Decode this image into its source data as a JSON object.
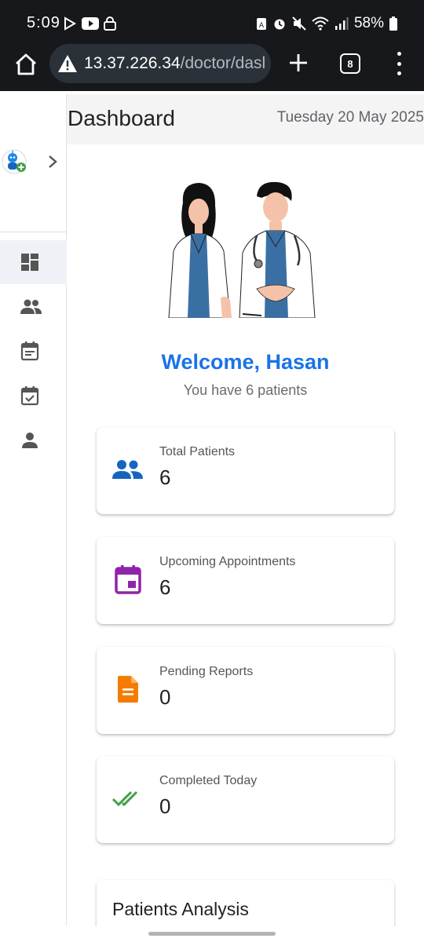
{
  "status_bar": {
    "time": "5:09",
    "battery_percent": "58%",
    "bg_color": "#17181c"
  },
  "browser": {
    "url_host": "13.37.226.34",
    "url_path": "/doctor/dasl",
    "tab_count": "8"
  },
  "header": {
    "title": "Dashboard",
    "date": "Tuesday 20 May 2025"
  },
  "sidebar": {
    "items": [
      {
        "icon": "dashboard-icon",
        "active": true
      },
      {
        "icon": "patients-icon",
        "active": false
      },
      {
        "icon": "calendar-icon",
        "active": false
      },
      {
        "icon": "event-check-icon",
        "active": false
      },
      {
        "icon": "profile-icon",
        "active": false
      }
    ]
  },
  "welcome": {
    "title": "Welcome, Hasan",
    "subtitle": "You have 6 patients"
  },
  "stats": [
    {
      "label": "Total Patients",
      "value": "6",
      "icon": "people-icon",
      "color": "#1565c0"
    },
    {
      "label": "Upcoming Appointments",
      "value": "6",
      "icon": "event-icon",
      "color": "#8e24aa"
    },
    {
      "label": "Pending Reports",
      "value": "0",
      "icon": "document-icon",
      "color": "#f57c00"
    },
    {
      "label": "Completed Today",
      "value": "0",
      "icon": "done-all-icon",
      "color": "#43a047"
    }
  ],
  "analysis": {
    "title": "Patients Analysis"
  },
  "colors": {
    "accent": "#1a73e8"
  }
}
